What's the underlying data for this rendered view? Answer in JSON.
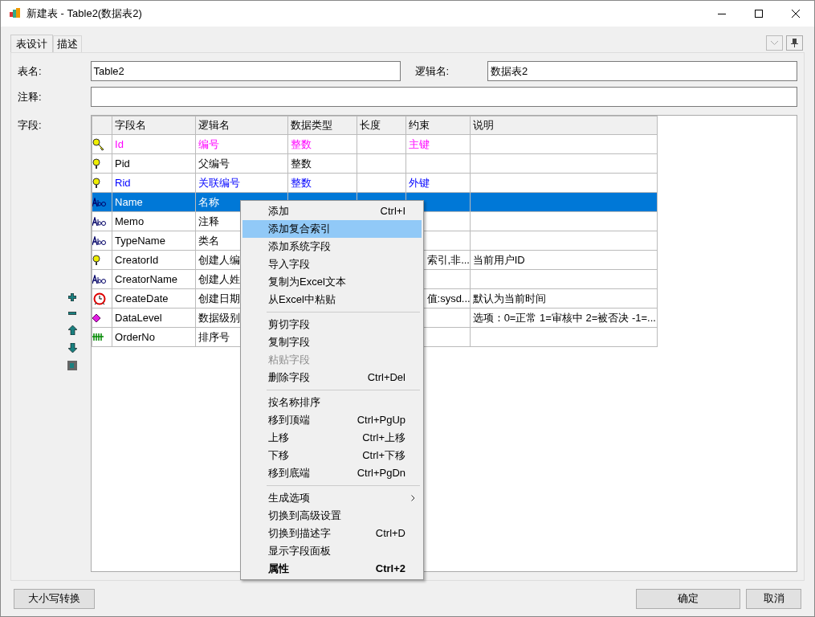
{
  "window": {
    "title": "新建表 - Table2(数据表2)"
  },
  "tabs": [
    {
      "label": "表设计",
      "selected": true
    },
    {
      "label": "描述",
      "selected": false
    }
  ],
  "form": {
    "table_name": {
      "label": "表名:",
      "value": "Table2"
    },
    "logical_name": {
      "label": "逻辑名:",
      "value": "数据表2"
    },
    "comment": {
      "label": "注释:"
    },
    "fields_label": "字段:"
  },
  "table": {
    "columns": [
      "字段名",
      "逻辑名",
      "数据类型",
      "长度",
      "约束",
      "说明"
    ],
    "rows": [
      {
        "kind": "primary-key",
        "name": "Id",
        "logical": "编号",
        "type": "整数",
        "constraint": "主键",
        "color": "#ff00ff",
        "selected": false
      },
      {
        "kind": "index",
        "name": "Pid",
        "logical": "父编号",
        "type": "整数",
        "color": "#000000",
        "selected": false
      },
      {
        "kind": "index",
        "name": "Rid",
        "logical": "关联编号",
        "type": "整数",
        "constraint": "外键",
        "color": "#0000ff",
        "selected": false
      },
      {
        "kind": "text",
        "name": "Name",
        "logical": "名称",
        "color": "#ffffff",
        "selected": true
      },
      {
        "kind": "text",
        "name": "Memo",
        "logical": "注释",
        "color": "#000000",
        "selected": false
      },
      {
        "kind": "text",
        "name": "TypeName",
        "logical": "类名",
        "color": "#000000",
        "selected": false
      },
      {
        "kind": "index",
        "name": "CreatorId",
        "logical": "创建人编",
        "constraint": "索引,非...",
        "note": "当前用户ID",
        "color": "#000000",
        "selected": false
      },
      {
        "kind": "text",
        "name": "CreatorName",
        "logical": "创建人姓",
        "color": "#000000",
        "selected": false
      },
      {
        "kind": "date",
        "name": "CreateDate",
        "logical": "创建日期",
        "constraint": "值:sysd...",
        "note": "默认为当前时间",
        "color": "#000000",
        "selected": false
      },
      {
        "kind": "enum",
        "name": "DataLevel",
        "logical": "数据级别",
        "note": "选项：0=正常 1=审核中 2=被否决 -1=...",
        "color": "#000000",
        "selected": false
      },
      {
        "kind": "number",
        "name": "OrderNo",
        "logical": "排序号",
        "color": "#000000",
        "selected": false
      }
    ]
  },
  "context_menu": [
    {
      "kind": "item",
      "label": "添加",
      "shortcut": "Ctrl+I",
      "selected": false,
      "disabled": false,
      "default": false,
      "submenu": false
    },
    {
      "kind": "item",
      "label": "添加复合索引",
      "selected": true,
      "disabled": false,
      "default": false,
      "submenu": false
    },
    {
      "kind": "item",
      "label": "添加系统字段",
      "selected": false,
      "disabled": false,
      "default": false,
      "submenu": false
    },
    {
      "kind": "item",
      "label": "导入字段",
      "selected": false,
      "disabled": false,
      "default": false,
      "submenu": false
    },
    {
      "kind": "item",
      "label": "复制为Excel文本",
      "selected": false,
      "disabled": false,
      "default": false,
      "submenu": false
    },
    {
      "kind": "item",
      "label": "从Excel中粘贴",
      "selected": false,
      "disabled": false,
      "default": false,
      "submenu": false
    },
    {
      "kind": "separator"
    },
    {
      "kind": "item",
      "label": "剪切字段",
      "selected": false,
      "disabled": false,
      "default": false,
      "submenu": false
    },
    {
      "kind": "item",
      "label": "复制字段",
      "selected": false,
      "disabled": false,
      "default": false,
      "submenu": false
    },
    {
      "kind": "item",
      "label": "粘贴字段",
      "selected": false,
      "disabled": true,
      "default": false,
      "submenu": false
    },
    {
      "kind": "item",
      "label": "删除字段",
      "shortcut": "Ctrl+Del",
      "selected": false,
      "disabled": false,
      "default": false,
      "submenu": false
    },
    {
      "kind": "separator"
    },
    {
      "kind": "item",
      "label": "按名称排序",
      "selected": false,
      "disabled": false,
      "default": false,
      "submenu": false
    },
    {
      "kind": "item",
      "label": "移到顶端",
      "shortcut": "Ctrl+PgUp",
      "selected": false,
      "disabled": false,
      "default": false,
      "submenu": false
    },
    {
      "kind": "item",
      "label": "上移",
      "shortcut": "Ctrl+上移",
      "selected": false,
      "disabled": false,
      "default": false,
      "submenu": false
    },
    {
      "kind": "item",
      "label": "下移",
      "shortcut": "Ctrl+下移",
      "selected": false,
      "disabled": false,
      "default": false,
      "submenu": false
    },
    {
      "kind": "item",
      "label": "移到底端",
      "shortcut": "Ctrl+PgDn",
      "selected": false,
      "disabled": false,
      "default": false,
      "submenu": false
    },
    {
      "kind": "separator"
    },
    {
      "kind": "item",
      "label": "生成选项",
      "selected": false,
      "disabled": false,
      "default": false,
      "submenu": true
    },
    {
      "kind": "item",
      "label": "切换到高级设置",
      "selected": false,
      "disabled": false,
      "default": false,
      "submenu": false
    },
    {
      "kind": "item",
      "label": "切换到描述字",
      "shortcut": "Ctrl+D",
      "selected": false,
      "disabled": false,
      "default": false,
      "submenu": false
    },
    {
      "kind": "item",
      "label": "显示字段面板",
      "selected": false,
      "disabled": false,
      "default": false,
      "submenu": false
    },
    {
      "kind": "item",
      "label": "属性",
      "shortcut": "Ctrl+2",
      "selected": false,
      "disabled": false,
      "default": true,
      "submenu": false
    }
  ],
  "buttons": {
    "left": "大小写转换",
    "ok": "确定",
    "cancel": "取消"
  }
}
